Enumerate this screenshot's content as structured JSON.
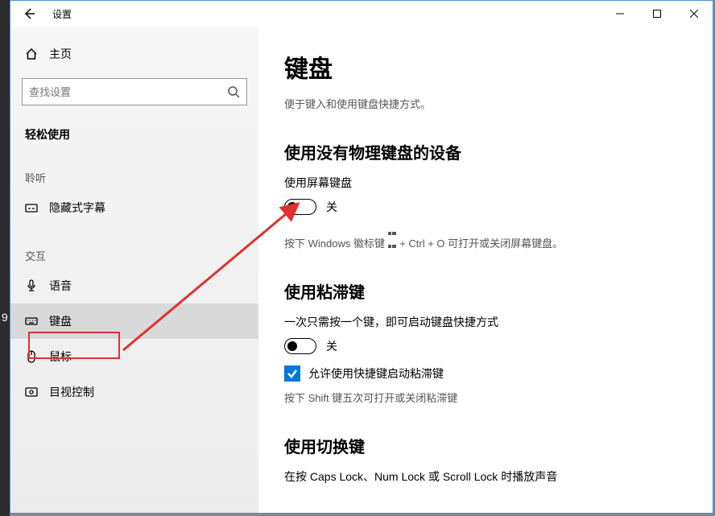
{
  "outside": {
    "digit": "9"
  },
  "window": {
    "title": "设置",
    "sidebar": {
      "home": "主页",
      "search_placeholder": "查找设置",
      "category": "轻松使用",
      "group_listen": "聆听",
      "item_captions": "隐藏式字幕",
      "group_interact": "交互",
      "item_speech": "语音",
      "item_keyboard": "键盘",
      "item_mouse": "鼠标",
      "item_eye": "目视控制"
    },
    "main": {
      "title": "键盘",
      "subtitle": "便于键入和使用键盘快捷方式。",
      "section1": {
        "heading": "使用没有物理键盘的设备",
        "label": "使用屏幕键盘",
        "state": "关",
        "desc_pre": "按下 Windows 徽标键 ",
        "desc_post": " + Ctrl + O 可打开或关闭屏幕键盘。"
      },
      "section2": {
        "heading": "使用粘滞键",
        "label": "一次只需按一个键，即可启动键盘快捷方式",
        "state": "关",
        "check_label": "允许使用快捷键启动粘滞键",
        "desc": "按下 Shift 键五次可打开或关闭粘滞键"
      },
      "section3": {
        "heading": "使用切换键",
        "label": "在按 Caps Lock、Num Lock 或 Scroll Lock 时播放声音"
      }
    }
  }
}
